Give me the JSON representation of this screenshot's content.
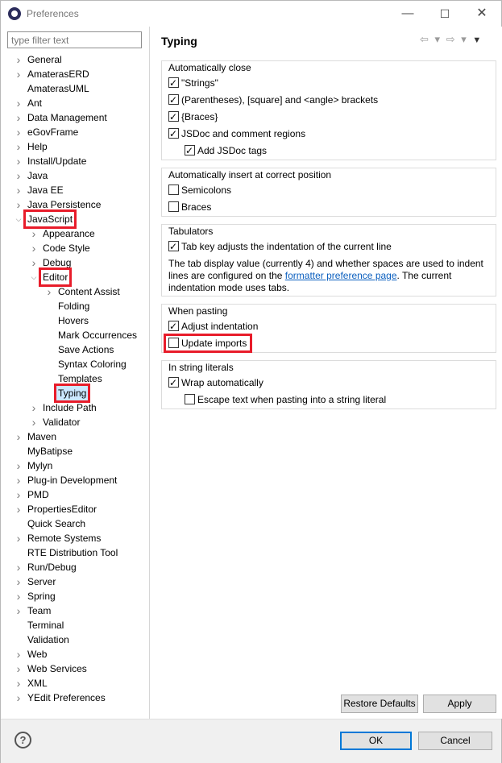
{
  "window": {
    "title": "Preferences",
    "minimize": "—",
    "maximize": "☐",
    "close": "✕"
  },
  "filter": {
    "placeholder": "type filter text",
    "value": ""
  },
  "tree": [
    {
      "label": "General",
      "depth": 0,
      "twisty": "collapsed"
    },
    {
      "label": "AmaterasERD",
      "depth": 0,
      "twisty": "collapsed"
    },
    {
      "label": "AmaterasUML",
      "depth": 0,
      "twisty": "none"
    },
    {
      "label": "Ant",
      "depth": 0,
      "twisty": "collapsed"
    },
    {
      "label": "Data Management",
      "depth": 0,
      "twisty": "collapsed"
    },
    {
      "label": "eGovFrame",
      "depth": 0,
      "twisty": "collapsed"
    },
    {
      "label": "Help",
      "depth": 0,
      "twisty": "collapsed"
    },
    {
      "label": "Install/Update",
      "depth": 0,
      "twisty": "collapsed"
    },
    {
      "label": "Java",
      "depth": 0,
      "twisty": "collapsed"
    },
    {
      "label": "Java EE",
      "depth": 0,
      "twisty": "collapsed"
    },
    {
      "label": "Java Persistence",
      "depth": 0,
      "twisty": "collapsed"
    },
    {
      "label": "JavaScript",
      "depth": 0,
      "twisty": "expanded",
      "highlight": true
    },
    {
      "label": "Appearance",
      "depth": 1,
      "twisty": "collapsed"
    },
    {
      "label": "Code Style",
      "depth": 1,
      "twisty": "collapsed"
    },
    {
      "label": "Debug",
      "depth": 1,
      "twisty": "collapsed"
    },
    {
      "label": "Editor",
      "depth": 1,
      "twisty": "expanded",
      "highlight": true
    },
    {
      "label": "Content Assist",
      "depth": 2,
      "twisty": "collapsed"
    },
    {
      "label": "Folding",
      "depth": 2,
      "twisty": "none"
    },
    {
      "label": "Hovers",
      "depth": 2,
      "twisty": "none"
    },
    {
      "label": "Mark Occurrences",
      "depth": 2,
      "twisty": "none"
    },
    {
      "label": "Save Actions",
      "depth": 2,
      "twisty": "none"
    },
    {
      "label": "Syntax Coloring",
      "depth": 2,
      "twisty": "none"
    },
    {
      "label": "Templates",
      "depth": 2,
      "twisty": "none"
    },
    {
      "label": "Typing",
      "depth": 2,
      "twisty": "none",
      "highlight": true,
      "selected": true
    },
    {
      "label": "Include Path",
      "depth": 1,
      "twisty": "collapsed"
    },
    {
      "label": "Validator",
      "depth": 1,
      "twisty": "collapsed"
    },
    {
      "label": "Maven",
      "depth": 0,
      "twisty": "collapsed"
    },
    {
      "label": "MyBatipse",
      "depth": 0,
      "twisty": "none"
    },
    {
      "label": "Mylyn",
      "depth": 0,
      "twisty": "collapsed"
    },
    {
      "label": "Plug-in Development",
      "depth": 0,
      "twisty": "collapsed"
    },
    {
      "label": "PMD",
      "depth": 0,
      "twisty": "collapsed"
    },
    {
      "label": "PropertiesEditor",
      "depth": 0,
      "twisty": "collapsed"
    },
    {
      "label": "Quick Search",
      "depth": 0,
      "twisty": "none"
    },
    {
      "label": "Remote Systems",
      "depth": 0,
      "twisty": "collapsed"
    },
    {
      "label": "RTE Distribution Tool",
      "depth": 0,
      "twisty": "none"
    },
    {
      "label": "Run/Debug",
      "depth": 0,
      "twisty": "collapsed"
    },
    {
      "label": "Server",
      "depth": 0,
      "twisty": "collapsed"
    },
    {
      "label": "Spring",
      "depth": 0,
      "twisty": "collapsed"
    },
    {
      "label": "Team",
      "depth": 0,
      "twisty": "collapsed"
    },
    {
      "label": "Terminal",
      "depth": 0,
      "twisty": "none"
    },
    {
      "label": "Validation",
      "depth": 0,
      "twisty": "none"
    },
    {
      "label": "Web",
      "depth": 0,
      "twisty": "collapsed"
    },
    {
      "label": "Web Services",
      "depth": 0,
      "twisty": "collapsed"
    },
    {
      "label": "XML",
      "depth": 0,
      "twisty": "collapsed"
    },
    {
      "label": "YEdit Preferences",
      "depth": 0,
      "twisty": "collapsed"
    }
  ],
  "page": {
    "title": "Typing",
    "nav": {
      "back": "⇦",
      "back_menu": "▾",
      "forward": "⇨",
      "forward_menu": "▾",
      "view_menu": "▼"
    },
    "groups": {
      "auto_close": {
        "title": "Automatically close",
        "options": [
          {
            "label": "\"Strings\"",
            "checked": true
          },
          {
            "label": "(Parentheses), [square] and <angle> brackets",
            "checked": true
          },
          {
            "label": "{Braces}",
            "checked": true
          },
          {
            "label": "JSDoc and comment regions",
            "checked": true
          },
          {
            "label": "Add JSDoc tags",
            "checked": true
          }
        ]
      },
      "auto_insert": {
        "title": "Automatically insert at correct position",
        "options": [
          {
            "label": "Semicolons",
            "checked": false
          },
          {
            "label": "Braces",
            "checked": false
          }
        ]
      },
      "tabulators": {
        "title": "Tabulators",
        "options": [
          {
            "label": "Tab key adjusts the indentation of the current line",
            "checked": true
          }
        ],
        "desc_before": "The tab display value (currently 4) and whether spaces are used to indent lines are configured on the ",
        "link": "formatter preference page",
        "desc_after": ". The current indentation mode uses tabs."
      },
      "pasting": {
        "title": "When pasting",
        "options": [
          {
            "label": "Adjust indentation",
            "checked": true
          },
          {
            "label": "Update imports",
            "checked": false,
            "highlight": true
          }
        ]
      },
      "strings": {
        "title": "In string literals",
        "options": [
          {
            "label": "Wrap automatically",
            "checked": true
          },
          {
            "label": "Escape text when pasting into a string literal",
            "checked": false
          }
        ]
      }
    },
    "buttons": {
      "restore": "Restore Defaults",
      "apply": "Apply"
    }
  },
  "footer": {
    "help": "?",
    "ok": "OK",
    "cancel": "Cancel"
  },
  "colors": {
    "highlight": "#e81c2a",
    "selection": "#cce8ff",
    "link": "#0b5fbf",
    "default_button_border": "#0078d7"
  }
}
